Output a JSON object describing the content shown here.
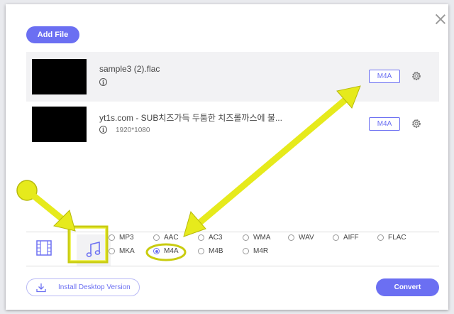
{
  "toolbar": {
    "add_file_label": "Add File"
  },
  "files": [
    {
      "name": "sample3 (2).flac",
      "resolution": "",
      "format": "M4A"
    },
    {
      "name": "yt1s.com - SUB치즈가득 두툼한 치즈롤까스에 불...",
      "resolution": "1920*1080",
      "format": "M4A"
    }
  ],
  "formats": {
    "row1": [
      "MP3",
      "AAC",
      "AC3",
      "WMA",
      "WAV",
      "AIFF",
      "FLAC"
    ],
    "row2": [
      "MKA",
      "M4A",
      "M4B",
      "M4R"
    ],
    "selected": "M4A"
  },
  "footer": {
    "install_label": "Install Desktop Version",
    "convert_label": "Convert"
  },
  "icons": {
    "info": "i",
    "close": "close-icon",
    "gear": "gear-icon",
    "film": "film-icon",
    "music": "music-note-icon",
    "download": "download-icon"
  },
  "colors": {
    "accent": "#6b6ff2",
    "annotation": "#e6ea1c"
  }
}
